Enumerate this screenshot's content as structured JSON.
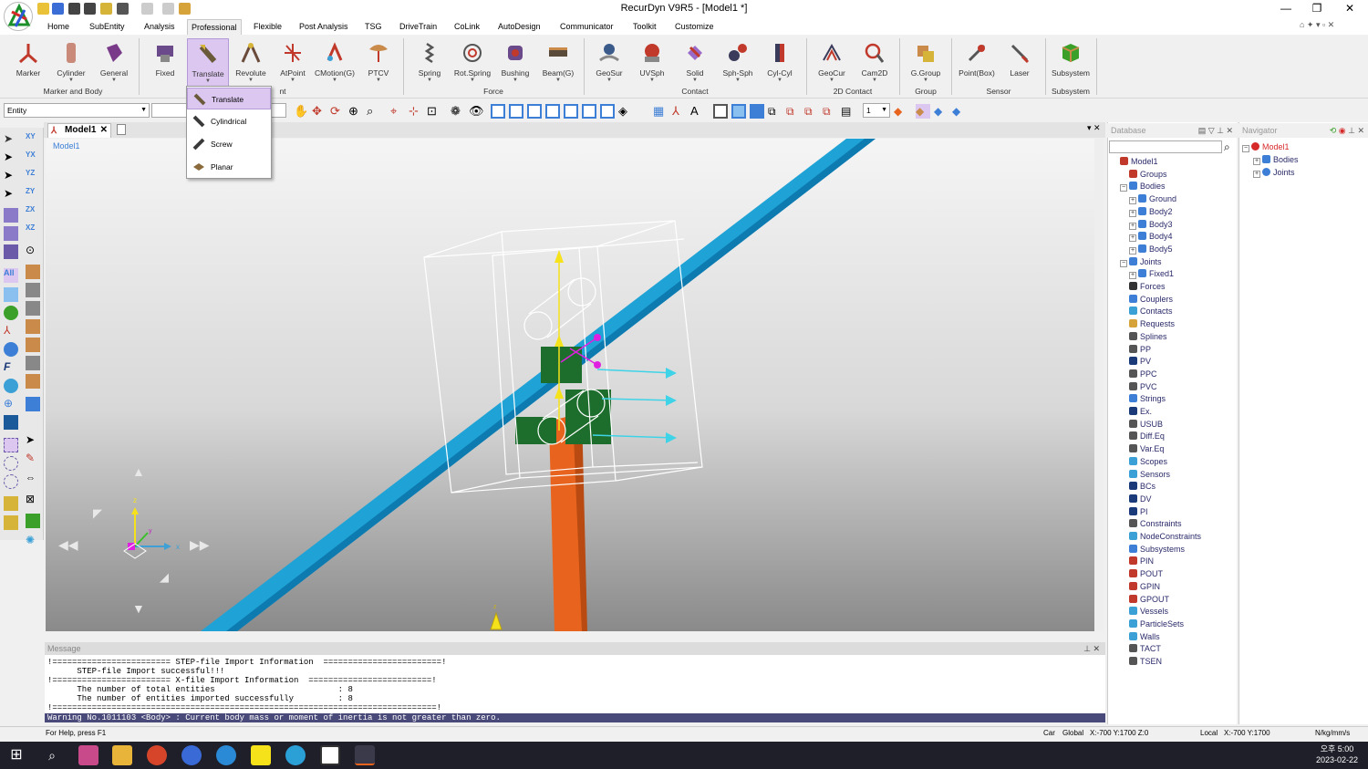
{
  "window": {
    "title": "RecurDyn V9R5  - [Model1 *]"
  },
  "ribbon_tabs": [
    "Home",
    "SubEntity",
    "Analysis",
    "Professional",
    "Flexible",
    "Post Analysis",
    "TSG",
    "DriveTrain",
    "CoLink",
    "AutoDesign",
    "Communicator",
    "Toolkit",
    "Customize"
  ],
  "active_tab": "Professional",
  "ribbon": {
    "marker_and_body": {
      "label": "Marker and Body",
      "buttons": [
        "Marker",
        "Cylinder",
        "General"
      ]
    },
    "joint": {
      "label": "Joint",
      "buttons": [
        "Fixed",
        "Translate",
        "Revolute",
        "AtPoint",
        "CMotion(G)",
        "PTCV"
      ]
    },
    "force": {
      "label": "Force",
      "buttons": [
        "Spring",
        "Rot.Spring",
        "Bushing",
        "Beam(G)"
      ]
    },
    "contact": {
      "label": "Contact",
      "buttons": [
        "GeoSur",
        "UVSph",
        "Solid",
        "Sph-Sph",
        "Cyl-Cyl"
      ]
    },
    "contact2d": {
      "label": "2D Contact",
      "buttons": [
        "GeoCur",
        "Cam2D"
      ]
    },
    "group": {
      "label": "Group",
      "buttons": [
        "G.Group"
      ]
    },
    "sensor": {
      "label": "Sensor",
      "buttons": [
        "Point(Box)",
        "Laser"
      ]
    },
    "subsystem": {
      "label": "Subsystem",
      "buttons": [
        "Subsystem"
      ]
    }
  },
  "dropdown": {
    "items": [
      "Translate",
      "Cylindrical",
      "Screw",
      "Planar"
    ],
    "highlighted": "Translate"
  },
  "toolbar": {
    "entity_select": "Entity",
    "page_num": "1"
  },
  "document": {
    "tab": "Model1",
    "viewport_label": "Model1"
  },
  "messages": {
    "header": "Message",
    "lines": [
      "!======================== STEP-file Import Information  ========================!",
      "      STEP-file Import successful!!!",
      "!======================== X-file Import Information  =========================!",
      "      The number of total entities                         : 8",
      "      The number of entities imported successfully         : 8",
      "!==============================================================================!"
    ],
    "warning": "Warning No.1011103 <Body> : Current body mass or moment of inertia is not greater than zero."
  },
  "status": {
    "help": "For Help, press F1",
    "car": "Car",
    "global": "Global",
    "global_coords": "X:-700 Y:1700 Z:0",
    "local": "Local",
    "local_coords": "X:-700 Y:1700",
    "units": "N/kg/mm/s"
  },
  "database": {
    "header": "Database",
    "tree": [
      {
        "label": "Model1",
        "level": 0,
        "color": "#c0392b"
      },
      {
        "label": "Groups",
        "level": 1,
        "color": "#c0392b"
      },
      {
        "label": "Bodies",
        "level": 1,
        "color": "#3d7fd6",
        "pm": "−"
      },
      {
        "label": "Ground",
        "level": 2,
        "color": "#3d7fd6",
        "pm": "+"
      },
      {
        "label": "Body2",
        "level": 2,
        "color": "#3d7fd6",
        "pm": "+"
      },
      {
        "label": "Body3",
        "level": 2,
        "color": "#3d7fd6",
        "pm": "+"
      },
      {
        "label": "Body4",
        "level": 2,
        "color": "#3d7fd6",
        "pm": "+"
      },
      {
        "label": "Body5",
        "level": 2,
        "color": "#3d7fd6",
        "pm": "+"
      },
      {
        "label": "Joints",
        "level": 1,
        "color": "#3d7fd6",
        "pm": "−"
      },
      {
        "label": "Fixed1",
        "level": 2,
        "color": "#3d7fd6",
        "pm": "+"
      },
      {
        "label": "Forces",
        "level": 1,
        "color": "#333"
      },
      {
        "label": "Couplers",
        "level": 1,
        "color": "#3d7fd6"
      },
      {
        "label": "Contacts",
        "level": 1,
        "color": "#3aa0d6"
      },
      {
        "label": "Requests",
        "level": 1,
        "color": "#d6a23a"
      },
      {
        "label": "Splines",
        "level": 1,
        "color": "#555"
      },
      {
        "label": "PP",
        "level": 1,
        "color": "#555"
      },
      {
        "label": "PV",
        "level": 1,
        "color": "#1a3a7a"
      },
      {
        "label": "PPC",
        "level": 1,
        "color": "#555"
      },
      {
        "label": "PVC",
        "level": 1,
        "color": "#555"
      },
      {
        "label": "Strings",
        "level": 1,
        "color": "#3d7fd6"
      },
      {
        "label": "Ex.",
        "level": 1,
        "color": "#1a3a7a"
      },
      {
        "label": "USUB",
        "level": 1,
        "color": "#555"
      },
      {
        "label": "Diff.Eq",
        "level": 1,
        "color": "#555"
      },
      {
        "label": "Var.Eq",
        "level": 1,
        "color": "#555"
      },
      {
        "label": "Scopes",
        "level": 1,
        "color": "#3aa0d6"
      },
      {
        "label": "Sensors",
        "level": 1,
        "color": "#3aa0d6"
      },
      {
        "label": "BCs",
        "level": 1,
        "color": "#1a3a7a"
      },
      {
        "label": "DV",
        "level": 1,
        "color": "#1a3a7a"
      },
      {
        "label": "PI",
        "level": 1,
        "color": "#1a3a7a"
      },
      {
        "label": "Constraints",
        "level": 1,
        "color": "#555"
      },
      {
        "label": "NodeConstraints",
        "level": 1,
        "color": "#3aa0d6"
      },
      {
        "label": "Subsystems",
        "level": 1,
        "color": "#3d7fd6"
      },
      {
        "label": "PIN",
        "level": 1,
        "color": "#c0392b"
      },
      {
        "label": "POUT",
        "level": 1,
        "color": "#c0392b"
      },
      {
        "label": "GPIN",
        "level": 1,
        "color": "#c0392b"
      },
      {
        "label": "GPOUT",
        "level": 1,
        "color": "#c0392b"
      },
      {
        "label": "Vessels",
        "level": 1,
        "color": "#3aa0d6"
      },
      {
        "label": "ParticleSets",
        "level": 1,
        "color": "#3aa0d6"
      },
      {
        "label": "Walls",
        "level": 1,
        "color": "#3aa0d6"
      },
      {
        "label": "TACT",
        "level": 1,
        "color": "#555"
      },
      {
        "label": "TSEN",
        "level": 1,
        "color": "#555"
      }
    ]
  },
  "navigator": {
    "header": "Navigator",
    "tree": [
      {
        "label": "Model1",
        "level": 0
      },
      {
        "label": "Bodies",
        "level": 1
      },
      {
        "label": "Joints",
        "level": 1
      }
    ]
  },
  "taskbar": {
    "time": "오후 5:00",
    "date": "2023-02-22"
  },
  "colors": {
    "ribbon_bg": "#f0f0f0",
    "selected": "#dcc7f0",
    "bar": "#1fa3d6",
    "post": "#e8641e",
    "block": "#1d6e2c",
    "axis_y": "#f5e21a",
    "axis_x": "#3fd3e8",
    "marker": "#e020e0"
  }
}
